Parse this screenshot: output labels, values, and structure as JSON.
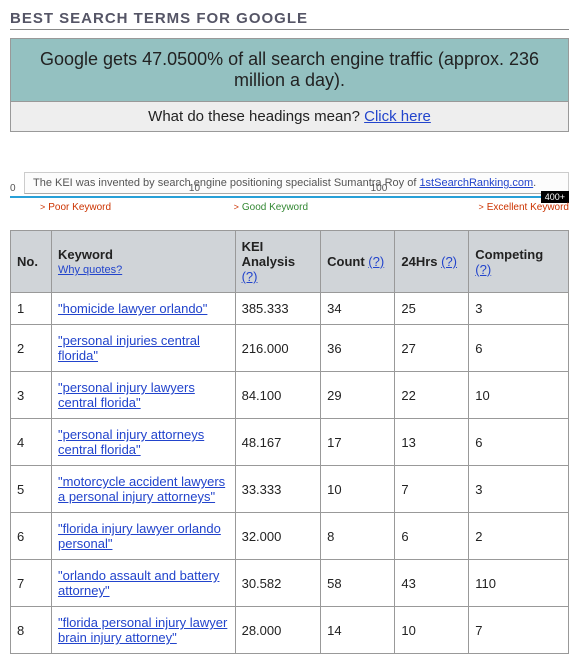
{
  "page_title": "BEST SEARCH TERMS FOR GOOGLE",
  "banner": {
    "main": "Google gets 47.0500% of all search engine traffic (approx. 236 million a day).",
    "sub_text": "What do these headings mean? ",
    "sub_link": "Click here"
  },
  "kei_note": {
    "prefix": "The KEI was invented by search engine positioning specialist Sumantra Roy of ",
    "source": "1stSearchRanking.com",
    "suffix": "."
  },
  "scale": {
    "t0": "0",
    "t10": "10",
    "t100": "100",
    "cap": "400+",
    "poor": "Poor Keyword",
    "good": "Good Keyword",
    "excellent": "Excellent Keyword"
  },
  "columns": {
    "no": "No.",
    "keyword": "Keyword",
    "keyword_sub": "Why quotes?",
    "kei_prefix": "KEI Analysis ",
    "count_prefix": "Count ",
    "hrs_prefix": "24Hrs ",
    "competing_prefix": "Competing ",
    "q": "(?)"
  },
  "rows": [
    {
      "no": "1",
      "keyword": "\"homicide lawyer orlando\"",
      "kei": "385.333",
      "count": "34",
      "hrs": "25",
      "competing": "3"
    },
    {
      "no": "2",
      "keyword": "\"personal injuries central florida\"",
      "kei": "216.000",
      "count": "36",
      "hrs": "27",
      "competing": "6"
    },
    {
      "no": "3",
      "keyword": "\"personal injury lawyers central florida\"",
      "kei": "84.100",
      "count": "29",
      "hrs": "22",
      "competing": "10"
    },
    {
      "no": "4",
      "keyword": "\"personal injury attorneys central florida\"",
      "kei": "48.167",
      "count": "17",
      "hrs": "13",
      "competing": "6"
    },
    {
      "no": "5",
      "keyword": "\"motorcycle accident lawyers a personal injury attorneys\"",
      "kei": "33.333",
      "count": "10",
      "hrs": "7",
      "competing": "3"
    },
    {
      "no": "6",
      "keyword": "\"florida injury lawyer orlando personal\"",
      "kei": "32.000",
      "count": "8",
      "hrs": "6",
      "competing": "2"
    },
    {
      "no": "7",
      "keyword": "\"orlando assault and battery attorney\"",
      "kei": "30.582",
      "count": "58",
      "hrs": "43",
      "competing": "110"
    },
    {
      "no": "8",
      "keyword": "\"florida personal injury lawyer brain injury attorney\"",
      "kei": "28.000",
      "count": "14",
      "hrs": "10",
      "competing": "7"
    }
  ]
}
